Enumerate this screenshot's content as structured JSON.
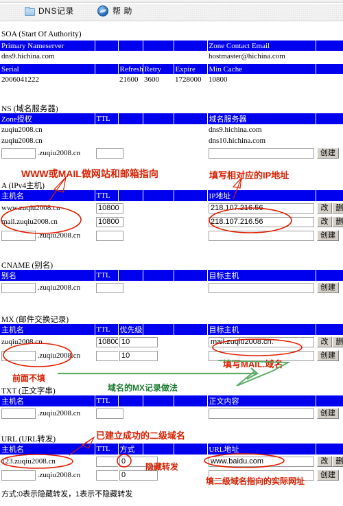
{
  "toolbar": {
    "dns_label": "DNS记录",
    "help_label": "帮 助",
    "folder_icon": "folder-icon",
    "help_icon": "help-icon"
  },
  "sections": {
    "soa": {
      "title": "SOA (Start Of Authority)",
      "header1": [
        "Primary Nameserver",
        "",
        "",
        "",
        "",
        "Zone Contact Email",
        ""
      ],
      "row1": [
        "dns9.hichina.com",
        "",
        "",
        "",
        "",
        "hostmaster@hichina.com",
        ""
      ],
      "header2": [
        "Serial",
        "",
        "Refresh",
        "Retry",
        "Expire",
        "Min Cache",
        ""
      ],
      "row2": [
        "2006041222",
        "",
        "21600",
        "3600",
        "1728000",
        "10800",
        ""
      ]
    },
    "ns": {
      "title": "NS (域名服务器)",
      "header": [
        "Zone授权",
        "TTL",
        "",
        "",
        "",
        "域名服务器",
        ""
      ],
      "rows": [
        {
          "host": "zuqiu2008.cn",
          "ttl": "",
          "target": "dns9.hichina.com",
          "action": ""
        },
        {
          "host": "zuqiu2008.cn",
          "ttl": "",
          "target": "dns10.hichina.com",
          "action": ""
        }
      ],
      "new_row": {
        "host": "",
        "suffix": ".zuqiu2008.cn",
        "ttl": "",
        "target": "",
        "button": "创建"
      }
    },
    "a": {
      "title": "A (IPv4主机)",
      "header": [
        "主机名",
        "TTL",
        "",
        "",
        "",
        "IP地址",
        ""
      ],
      "rows": [
        {
          "host": "www.zuqiu2008.cn",
          "ttl": "10800",
          "ip": "218.107.216.56",
          "edit": "改",
          "del": "删"
        },
        {
          "host": "mail.zuqiu2008.cn",
          "ttl": "10800",
          "ip": "218.107.216.56",
          "edit": "改",
          "del": "删"
        }
      ],
      "new_row": {
        "host": "",
        "suffix": ".zuqiu2008.cn",
        "ttl": "",
        "ip": "",
        "button": "创建"
      }
    },
    "cname": {
      "title": "CNAME (别名)",
      "header": [
        "别名",
        "TTL",
        "",
        "",
        "",
        "目标主机",
        ""
      ],
      "new_row": {
        "host": "",
        "suffix": ".zuqiu2008.cn",
        "ttl": "",
        "target": "",
        "button": "创建"
      }
    },
    "mx": {
      "title": "MX (邮件交换记录)",
      "header": [
        "主机名",
        "TTL",
        "优先级",
        "",
        "",
        "目标主机",
        ""
      ],
      "rows": [
        {
          "host": "zuqiu2008.cn",
          "ttl": "10800",
          "prio": "10",
          "target": "mail.zuqiu2008.cn.",
          "edit": "改",
          "del": "删"
        }
      ],
      "new_row": {
        "host": "",
        "suffix": ".zuqiu2008.cn",
        "ttl": "",
        "prio": "10",
        "target": "",
        "button": "创建"
      }
    },
    "txt": {
      "title": "TXT (正文字串)",
      "header": [
        "主机名",
        "TTL",
        "",
        "",
        "",
        "正文内容",
        ""
      ],
      "new_row": {
        "host": "",
        "suffix": ".zuqiu2008.cn",
        "ttl": "",
        "content": "",
        "button": "创建"
      }
    },
    "url": {
      "title": "URL (URL转发)",
      "header": [
        "主机名",
        "TTL",
        "方式",
        "",
        "",
        "URL地址",
        ""
      ],
      "rows": [
        {
          "host": "123.zuqiu2008.cn",
          "ttl": "",
          "mode": "0",
          "url": "www.baidu.com",
          "edit": "改",
          "del": "删"
        }
      ],
      "new_row": {
        "host": "",
        "suffix": ".zuqiu2008.cn",
        "ttl": "",
        "mode": "0",
        "url": "",
        "button": "创建"
      },
      "footnote": "方式:0表示隐藏转发，1表示不隐藏转发"
    }
  },
  "annotations": {
    "a_host_note": "WWW或MAIL做网站和邮箱指向",
    "a_ip_note": "填写相对应的IP地址",
    "mx_target_note": "填写MAIL.域名",
    "mx_host_note": "前面不填",
    "mx_method_note": "域名的MX记录做法",
    "url_host_note": "已建立成功的二级域名",
    "url_mode_note": "隐藏转发",
    "url_addr_note": "填二级域名指向的实际网址"
  },
  "colors": {
    "header_blue": "#0000ee",
    "annotation_red": "#d62000",
    "annotation_green": "#1a7a2e",
    "button_face": "#d4d0c8"
  }
}
